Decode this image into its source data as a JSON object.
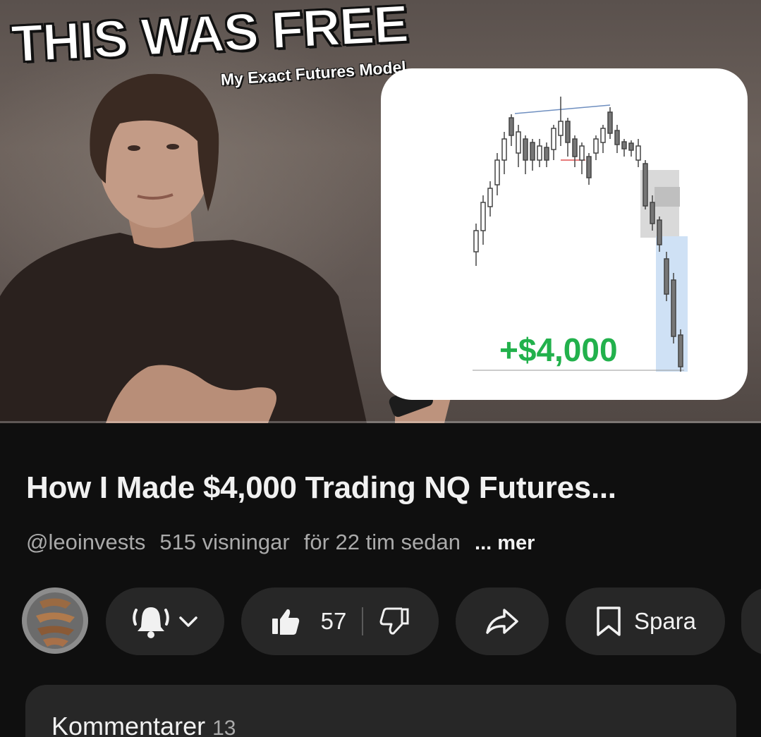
{
  "thumbnail": {
    "title": "THIS WAS FREE",
    "subtitle": "My Exact Futures Model",
    "profit_label": "+$4,000",
    "progress_fraction": 0.0
  },
  "video": {
    "title": "How I Made $4,000 Trading NQ Futures...",
    "channel_handle": "@leoinvests",
    "views": "515 visningar",
    "age": "för 22 tim sedan",
    "more_label": "... mer"
  },
  "actions": {
    "like_count": "57",
    "save_label": "Spara"
  },
  "comments": {
    "label": "Kommentarer",
    "count": "13"
  },
  "colors": {
    "background": "#0f0f0f",
    "pill": "#272727",
    "profit_green": "#22b14c",
    "progress_red": "#e62117"
  },
  "icons": [
    "bell-ringing-icon",
    "chevron-down-icon",
    "thumbs-up-icon",
    "thumbs-down-icon",
    "share-arrow-icon",
    "bookmark-icon"
  ]
}
